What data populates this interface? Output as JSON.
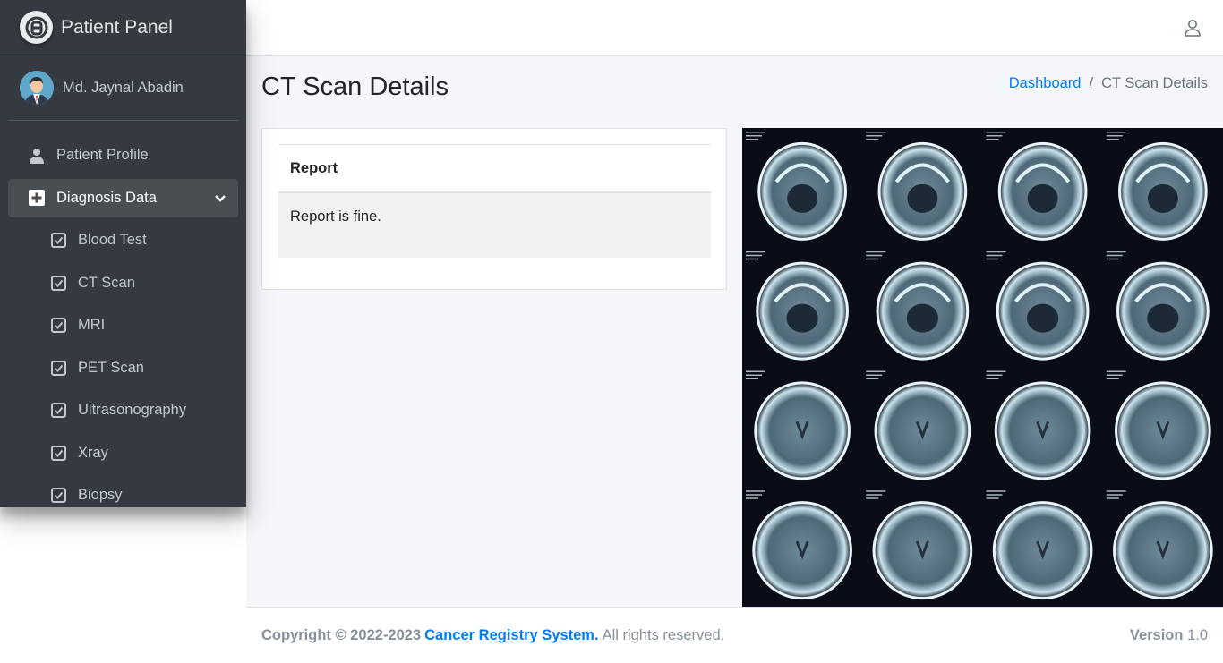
{
  "brand": {
    "title": "Patient Panel"
  },
  "user": {
    "name": "Md. Jaynal Abadin"
  },
  "sidebar": {
    "profile": "Patient Profile",
    "diagnosis": "Diagnosis Data",
    "sub_items": [
      "Blood Test",
      "CT Scan",
      "MRI",
      "PET Scan",
      "Ultrasonography",
      "Xray",
      "Biopsy"
    ]
  },
  "page": {
    "title": "CT Scan Details"
  },
  "breadcrumb": {
    "home": "Dashboard",
    "sep": "/",
    "current": "CT Scan Details"
  },
  "report": {
    "header": "Report",
    "text": "Report is fine."
  },
  "footer": {
    "copyright": "Copyright © 2022-2023",
    "org": "Cancer Registry System.",
    "rights": "All rights reserved.",
    "version_label": "Version",
    "version_value": "1.0"
  },
  "colors": {
    "sidebar": "#343a40",
    "link": "#007bff",
    "content_bg": "#f4f6f9"
  }
}
